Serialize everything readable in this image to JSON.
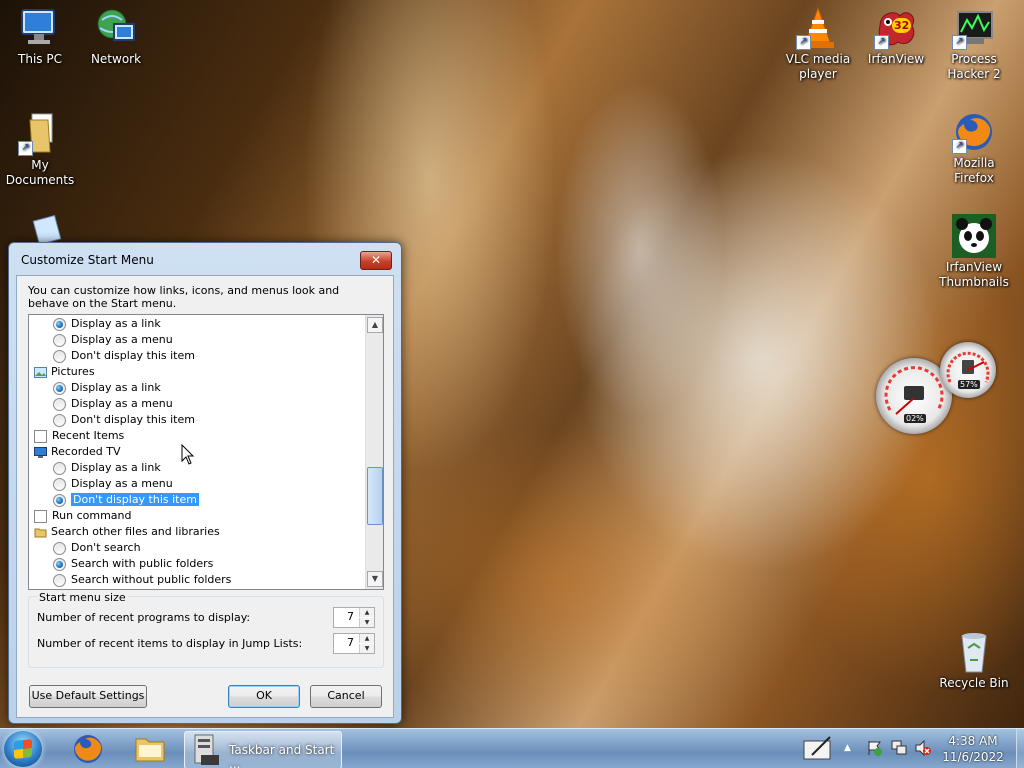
{
  "desktop": {
    "icons_left": [
      {
        "label": "This PC",
        "icon": "computer-icon"
      },
      {
        "label": "Network",
        "icon": "network-icon"
      },
      {
        "label": "My Documents",
        "icon": "documents-folder-icon"
      }
    ],
    "icons_right": [
      {
        "label": "VLC media player",
        "icon": "vlc-cone-icon"
      },
      {
        "label": "IrfanView",
        "icon": "irfanview-icon"
      },
      {
        "label": "Process Hacker 2",
        "icon": "process-hacker-icon"
      },
      {
        "label": "Mozilla Firefox",
        "icon": "firefox-icon"
      },
      {
        "label": "IrfanView Thumbnails",
        "icon": "panda-icon"
      },
      {
        "label": "Recycle Bin",
        "icon": "recycle-bin-icon"
      }
    ],
    "irfanview_badge": "32",
    "gadget": {
      "cpu_value": "02%",
      "mem_value": "57%"
    }
  },
  "dialog": {
    "title": "Customize Start Menu",
    "close_label": "✕",
    "description": "You can customize how links, icons, and menus look and behave on the Start menu.",
    "list_rows": [
      {
        "kind": "radio",
        "label": "Display as a link",
        "checked": true
      },
      {
        "kind": "radio",
        "label": "Display as a menu",
        "checked": false
      },
      {
        "kind": "radio",
        "label": "Don't display this item",
        "checked": false
      },
      {
        "kind": "header",
        "label": "Pictures",
        "icon": "pictures-icon"
      },
      {
        "kind": "radio",
        "label": "Display as a link",
        "checked": true
      },
      {
        "kind": "radio",
        "label": "Display as a menu",
        "checked": false
      },
      {
        "kind": "radio",
        "label": "Don't display this item",
        "checked": false
      },
      {
        "kind": "check",
        "label": "Recent Items",
        "checked": false
      },
      {
        "kind": "header",
        "label": "Recorded TV",
        "icon": "recorded-tv-icon"
      },
      {
        "kind": "radio",
        "label": "Display as a link",
        "checked": false
      },
      {
        "kind": "radio",
        "label": "Display as a menu",
        "checked": false
      },
      {
        "kind": "radio",
        "label": "Don't display this item",
        "checked": true,
        "selected": true
      },
      {
        "kind": "check",
        "label": "Run command",
        "checked": false
      },
      {
        "kind": "header",
        "label": "Search other files and libraries",
        "icon": "search-folder-icon"
      },
      {
        "kind": "radio",
        "label": "Don't search",
        "checked": false
      },
      {
        "kind": "radio",
        "label": "Search with public folders",
        "checked": true
      },
      {
        "kind": "radio",
        "label": "Search without public folders",
        "checked": false
      }
    ],
    "start_menu_size": {
      "group_label": "Start menu size",
      "recent_programs_label": "Number of recent programs to display:",
      "recent_programs_value": "7",
      "recent_items_label": "Number of recent items to display in Jump Lists:",
      "recent_items_value": "7"
    },
    "buttons": {
      "default_settings": "Use Default Settings",
      "ok": "OK",
      "cancel": "Cancel"
    }
  },
  "taskbar": {
    "active_task_label": "Taskbar and Start ...",
    "clock_time": "4:38 AM",
    "clock_date": "11/6/2022"
  }
}
